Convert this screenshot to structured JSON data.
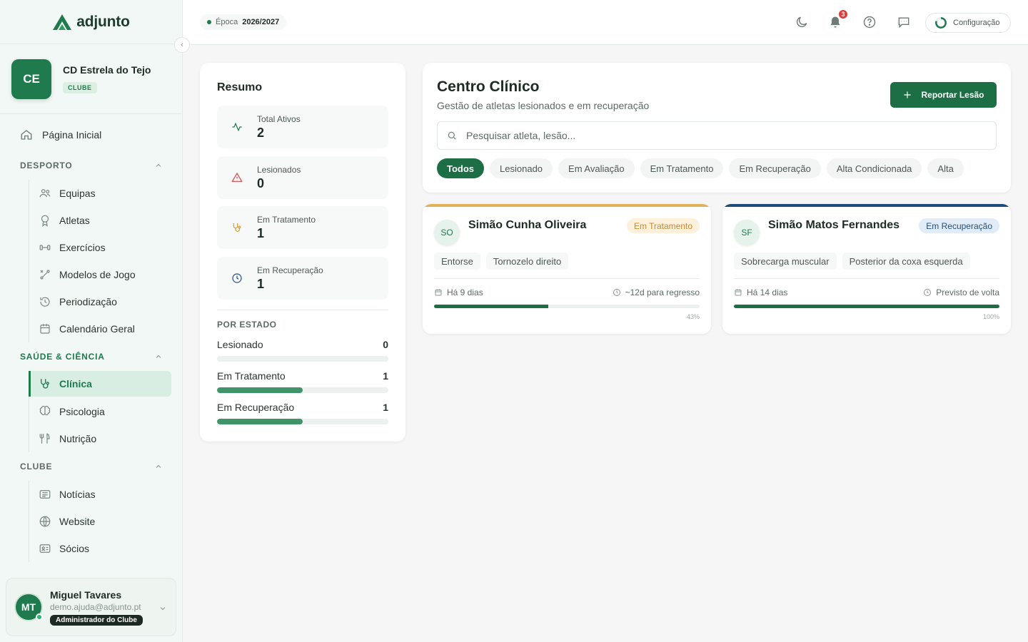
{
  "app": {
    "logo_text": "adjunto"
  },
  "club": {
    "initials": "CE",
    "name": "CD Estrela do Tejo",
    "badge": "CLUBE"
  },
  "nav": {
    "home": "Página Inicial",
    "sections": [
      {
        "title": "DESPORTO",
        "items": [
          "Equipas",
          "Atletas",
          "Exercícios",
          "Modelos de Jogo",
          "Periodização",
          "Calendário Geral"
        ]
      },
      {
        "title": "SAÚDE & CIÊNCIA",
        "items": [
          "Clínica",
          "Psicologia",
          "Nutrição"
        ],
        "active": "Clínica"
      },
      {
        "title": "CLUBE",
        "items": [
          "Notícias",
          "Website",
          "Sócios"
        ]
      }
    ]
  },
  "user": {
    "initials": "MT",
    "name": "Miguel Tavares",
    "email": "demo.ajuda@adjunto.pt",
    "role": "Administrador do Clube"
  },
  "header": {
    "season_label": "Época",
    "season_value": "2026/2027",
    "notifications": "3",
    "config_label": "Configuração"
  },
  "summary": {
    "title": "Resumo",
    "stats": [
      {
        "label": "Total Ativos",
        "value": "2",
        "icon": "activity-icon"
      },
      {
        "label": "Lesionados",
        "value": "0",
        "icon": "alert-triangle-icon"
      },
      {
        "label": "Em Tratamento",
        "value": "1",
        "icon": "stethoscope-icon"
      },
      {
        "label": "Em Recuperação",
        "value": "1",
        "icon": "clock-icon"
      }
    ],
    "by_state_title": "POR ESTADO",
    "by_state": [
      {
        "label": "Lesionado",
        "value": "0",
        "fraction": 0
      },
      {
        "label": "Em Tratamento",
        "value": "1",
        "fraction": 0.5
      },
      {
        "label": "Em Recuperação",
        "value": "1",
        "fraction": 0.5
      }
    ]
  },
  "main": {
    "title": "Centro Clínico",
    "subtitle": "Gestão de atletas lesionados e em recuperação",
    "report_label": "Reportar Lesão",
    "search_placeholder": "Pesquisar atleta, lesão...",
    "filters": [
      "Todos",
      "Lesionado",
      "Em Avaliação",
      "Em Tratamento",
      "Em Recuperação",
      "Alta Condicionada",
      "Alta"
    ],
    "active_filter": "Todos"
  },
  "athletes": [
    {
      "initials": "SO",
      "name": "Simão Cunha Oliveira",
      "status": "Em Tratamento",
      "status_color": "#c9892a",
      "status_bg": "#fdf1dc",
      "accent": "#e0b25c",
      "injury": "Entorse",
      "location": "Tornozelo direito",
      "since": "Há 9 dias",
      "eta": "~12d para regresso",
      "progress": 43,
      "progress_label": "43%"
    },
    {
      "initials": "SF",
      "name": "Simão Matos Fernandes",
      "status": "Em Recuperação",
      "status_color": "#24507e",
      "status_bg": "#e2ecf7",
      "accent": "#1f4c7a",
      "injury": "Sobrecarga muscular",
      "location": "Posterior da coxa esquerda",
      "since": "Há 14 dias",
      "eta": "Previsto de volta",
      "progress": 100,
      "progress_label": "100%"
    }
  ]
}
